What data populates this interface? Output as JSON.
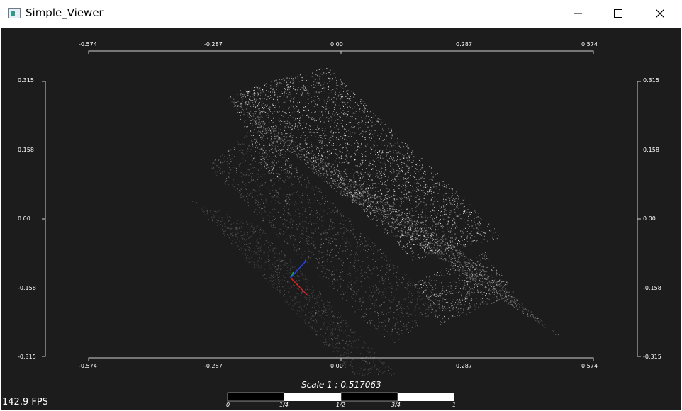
{
  "window": {
    "title": "Simple_Viewer"
  },
  "controls": {
    "minimize": "minimize-icon",
    "maximize": "maximize-icon",
    "close": "close-icon"
  },
  "axes": {
    "top_ticks": [
      "-0.574",
      "-0.287",
      "0.00",
      "0.287",
      "0.574"
    ],
    "bottom_ticks": [
      "-0.574",
      "-0.287",
      "0.00",
      "0.287",
      "0.574"
    ],
    "left_ticks": [
      "0.315",
      "0.158",
      "0.00",
      "-0.158",
      "-0.315"
    ],
    "right_ticks": [
      "0.315",
      "0.158",
      "0.00",
      "-0.158",
      "-0.315"
    ]
  },
  "scale": {
    "label": "Scale 1 : 0.517063",
    "bar_ticks": [
      "0",
      "1/4",
      "1/2",
      "3/4",
      "1"
    ]
  },
  "status": {
    "fps": "142.9 FPS"
  },
  "colors": {
    "background": "#1c1c1c",
    "points": "#ffffff",
    "axis_x": "#ff2020",
    "axis_y": "#20c020",
    "axis_z": "#2040ff"
  }
}
